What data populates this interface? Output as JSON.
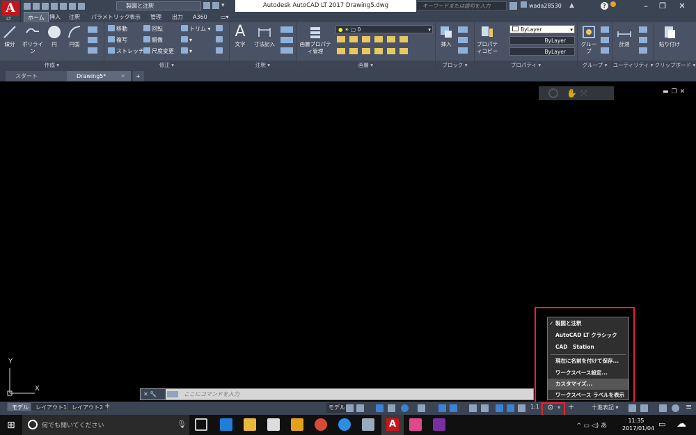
{
  "app": {
    "logo": "A",
    "logo_sub": "LT",
    "title": "Autodesk AutoCAD LT 2017    Drawing5.dwg",
    "workspace": "製図と注釈",
    "search_placeholder": "キーワードまたは語句を入力",
    "user": "wada28530"
  },
  "ribbon_tabs": [
    "ホーム",
    "挿入",
    "注釈",
    "パラメトリック",
    "表示",
    "管理",
    "出力",
    "A360"
  ],
  "panels": {
    "create": {
      "title": "作成",
      "buttons": [
        "線分",
        "ポリライン",
        "円",
        "円弧"
      ]
    },
    "modify": {
      "title": "修正",
      "items": [
        "移動",
        "回転",
        "トリム",
        "複写",
        "鏡像",
        "ストレッチ",
        "尺度変更"
      ]
    },
    "annotation": {
      "title": "注釈",
      "buttons": [
        "文字",
        "寸法記入"
      ]
    },
    "layers": {
      "title": "画層",
      "button": "画層プロパティ管理",
      "current": "0"
    },
    "block": {
      "title": "ブロック",
      "button": "挿入"
    },
    "properties": {
      "title": "プロパティ",
      "button": "プロパティコピー",
      "color": "ByLayer",
      "linetype": "ByLayer",
      "lineweight": "ByLayer"
    },
    "groups": {
      "title": "グループ",
      "button": "グループ"
    },
    "utilities": {
      "title": "ユーティリティ",
      "button": "計測"
    },
    "clipboard": {
      "title": "クリップボード",
      "button": "貼り付け"
    }
  },
  "file_tabs": [
    "スタート",
    "Drawing5*"
  ],
  "command_placeholder": "ここにコマンドを入力",
  "layout_tabs": [
    "モデル",
    "レイアウト1",
    "レイアウト2"
  ],
  "status": {
    "model": "モデル",
    "scale": "1:1",
    "units": "十進表記"
  },
  "ucs": {
    "x": "X",
    "y": "Y"
  },
  "workspace_menu": {
    "items": [
      "製図と注釈",
      "AutoCAD LT クラシック",
      "CAD　Station",
      "現在に名前を付けて保存...",
      "ワークスペース設定...",
      "カスタマイズ...",
      "ワークスペース ラベルを表示"
    ],
    "checked": "✓",
    "highlighted_index": 5
  },
  "taskbar": {
    "search": "何でも聞いてください",
    "time": "11:35",
    "date": "2017/01/04",
    "ime": "あ"
  },
  "colors": {
    "highlight_box": "#e8232a",
    "autocad_red": "#c4161c"
  }
}
